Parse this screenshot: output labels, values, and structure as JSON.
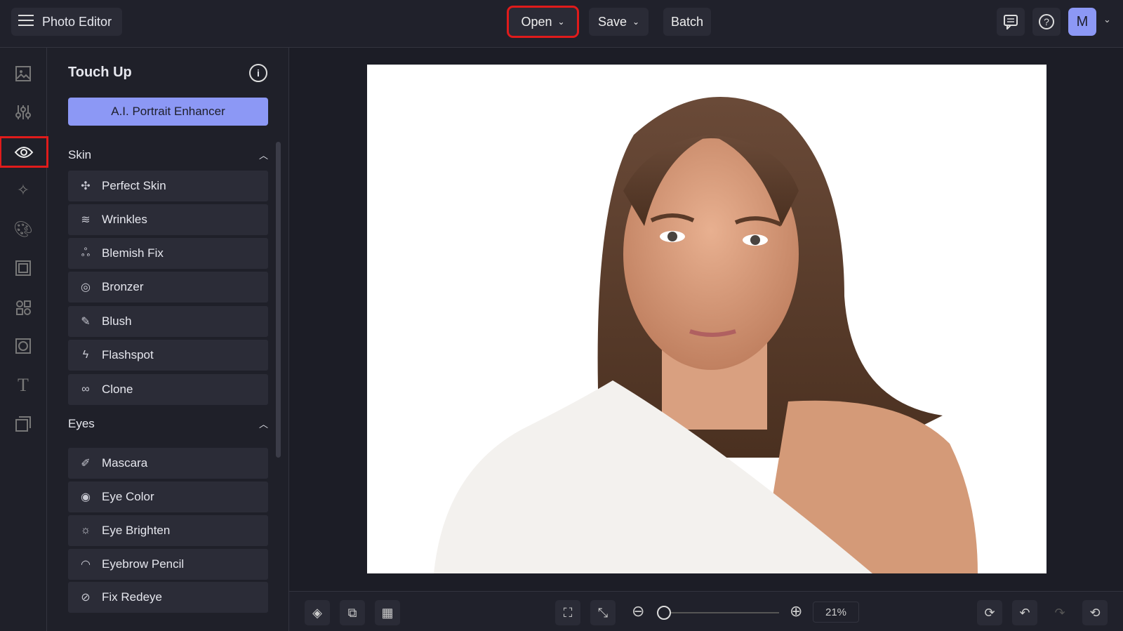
{
  "app": {
    "title": "Photo Editor"
  },
  "toolbar": {
    "open": "Open",
    "save": "Save",
    "batch": "Batch",
    "avatar": "M"
  },
  "panel": {
    "title": "Touch Up",
    "ai_button": "A.I. Portrait Enhancer",
    "sections": [
      {
        "label": "Skin",
        "items": [
          {
            "label": "Perfect Skin",
            "icon": "✣"
          },
          {
            "label": "Wrinkles",
            "icon": "≋"
          },
          {
            "label": "Blemish Fix",
            "icon": "ஃ"
          },
          {
            "label": "Bronzer",
            "icon": "◎"
          },
          {
            "label": "Blush",
            "icon": "✎"
          },
          {
            "label": "Flashspot",
            "icon": "ϟ"
          },
          {
            "label": "Clone",
            "icon": "∞"
          }
        ]
      },
      {
        "label": "Eyes",
        "items": [
          {
            "label": "Mascara",
            "icon": "✐"
          },
          {
            "label": "Eye Color",
            "icon": "◉"
          },
          {
            "label": "Eye Brighten",
            "icon": "☼"
          },
          {
            "label": "Eyebrow Pencil",
            "icon": "◠"
          },
          {
            "label": "Fix Redeye",
            "icon": "⊘"
          }
        ]
      }
    ]
  },
  "zoom": {
    "value": "21%",
    "fraction": 0.05
  },
  "colors": {
    "accent": "#8c98f5",
    "highlight": "#e01b1b"
  }
}
